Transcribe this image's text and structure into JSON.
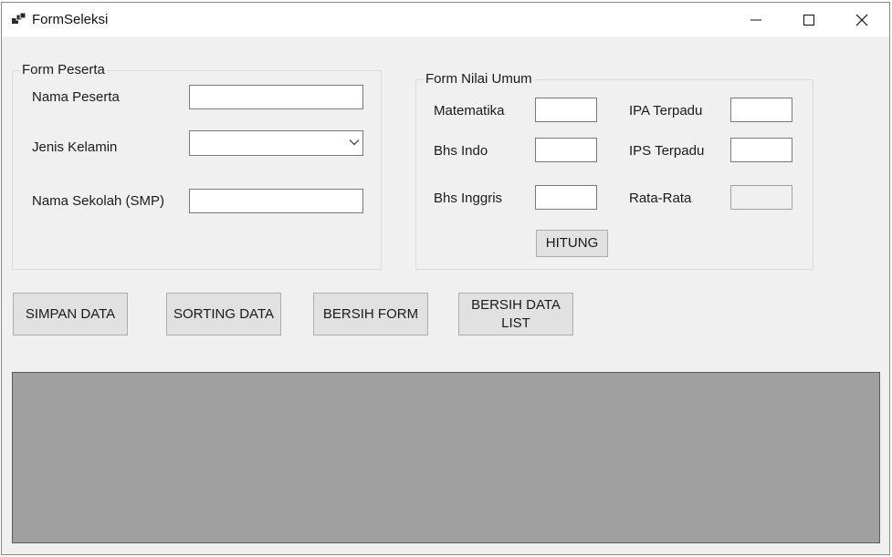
{
  "window": {
    "title": "FormSeleksi",
    "icon": "app-window-icon"
  },
  "form_peserta": {
    "legend": "Form Peserta",
    "nama_label": "Nama Peserta",
    "nama_value": "",
    "jenis_kelamin_label": "Jenis Kelamin",
    "jenis_kelamin_value": "",
    "sekolah_label": "Nama Sekolah (SMP)",
    "sekolah_value": ""
  },
  "form_nilai": {
    "legend": "Form Nilai Umum",
    "matematika_label": "Matematika",
    "ipa_label": "IPA Terpadu",
    "bhs_indo_label": "Bhs Indo",
    "ips_label": "IPS Terpadu",
    "bhs_inggris_label": "Bhs Inggris",
    "rata_label": "Rata-Rata",
    "hitung_label": "HITUNG"
  },
  "actions": {
    "simpan": "SIMPAN DATA",
    "sorting": "SORTING DATA",
    "bersih_form": "BERSIH FORM",
    "bersih_list": "BERSIH DATA\nLIST"
  },
  "colors": {
    "window_bg": "#f0f0f0",
    "list_bg": "#a0a0a0",
    "button_bg": "#e1e1e1"
  }
}
